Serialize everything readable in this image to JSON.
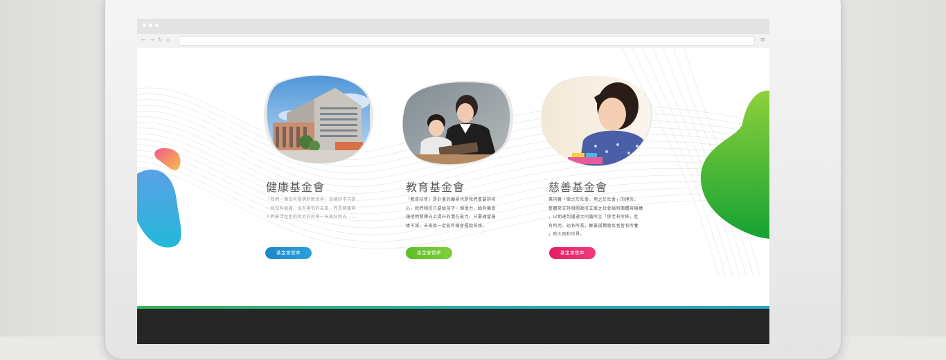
{
  "browser": {
    "nav_back": "←",
    "nav_forward": "→",
    "nav_refresh": "↻",
    "nav_home": "⌂",
    "menu": "≡"
  },
  "cards": [
    {
      "title": "健康基金會",
      "lines": [
        "「我們一個沒有疾病的新世界」這樣的不只是",
        "一個沒有病痛、沒有害怕的未來，而是健康與",
        "人們學活起生的和另外的每一天美好時光……"
      ],
      "button": "基金會使命",
      "text_color": "#9a9a9a",
      "button_colors": [
        "#1e86c6",
        "#2aa2db"
      ]
    },
    {
      "title": "教育基金會",
      "lines": [
        "「教育扶貧」是計畫的願景也是我們重要的核",
        "心，我們相信只要給孩子一個潛力、給有機會",
        "讓他們發揮向上提升的潛在能力，只要適當善",
        "緣不滅，未來就一定能有機會擺脫貧境。"
      ],
      "button": "基金會使命",
      "text_color": "#5a5a5a",
      "button_colors": [
        "#5ebc2a",
        "#7fcf3a"
      ]
    },
    {
      "title": "慈善基金會",
      "lines": [
        "秉持著「取之於社會，用之於社會」的理念，",
        "整體來支持相關政府立案之社會福利團體與機構",
        "，以期達到謹遵大同篇所言「使老有所終，壯",
        "有所用，幼有所長，鰥寡孤獨廢疾者皆有所養",
        "」的大同和世界。"
      ],
      "button": "基金會使命",
      "text_color": "#5a5a5a",
      "button_colors": [
        "#e11e63",
        "#f03a7c"
      ]
    }
  ],
  "colors": {
    "title": "#595959",
    "footer": "#262626",
    "accent_line": "#2aaf9a"
  }
}
